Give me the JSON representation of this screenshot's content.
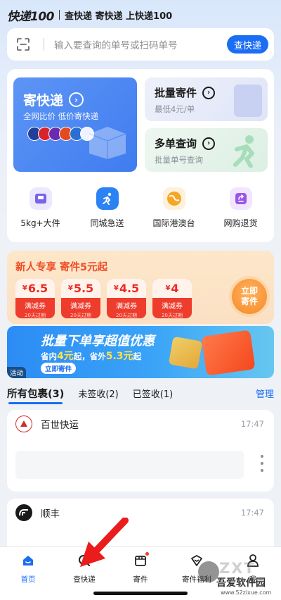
{
  "header": {
    "logo": "快递100",
    "slogan": "查快递 寄快递 上快递100"
  },
  "search": {
    "placeholder": "输入要查询的单号或扫码单号",
    "button": "查快递"
  },
  "services": {
    "send": {
      "title": "寄快递",
      "subtitle": "全网比价 低价寄快递",
      "arrow": "›"
    },
    "batch_send": {
      "title": "批量寄件",
      "subtitle": "最低4元/单",
      "arrow": "›"
    },
    "multi_query": {
      "title": "多单查询",
      "subtitle": "批量单号查询",
      "arrow": "›"
    },
    "grid": [
      {
        "label": "5kg+大件",
        "icon": "scale-icon",
        "color": "#7a63e6"
      },
      {
        "label": "同城急送",
        "icon": "runner-icon",
        "color": "#2b82f3"
      },
      {
        "label": "国际港澳台",
        "icon": "globe-icon",
        "color": "#f6a623"
      },
      {
        "label": "网购退货",
        "icon": "return-icon",
        "color": "#9b55e8"
      }
    ]
  },
  "promo": {
    "title": "新人专享 寄件5元起",
    "coupons": [
      {
        "currency": "¥",
        "amount": "6.5",
        "label": "满减券",
        "expire": "20天过期"
      },
      {
        "currency": "¥",
        "amount": "5.5",
        "label": "满减券",
        "expire": "20天过期"
      },
      {
        "currency": "¥",
        "amount": "4.5",
        "label": "满减券",
        "expire": "20天过期"
      },
      {
        "currency": "¥",
        "amount": "4",
        "label": "满减券",
        "expire": "20天过期"
      }
    ],
    "cta_line1": "立即",
    "cta_line2": "寄件"
  },
  "banner": {
    "headline": "批量下单享超值优惠",
    "sub_a": "省内",
    "sub_b": "4元",
    "sub_c": "起，省外",
    "sub_d": "5.3元",
    "sub_e": "起",
    "button": "立即寄件",
    "tag": "活动"
  },
  "tabs": {
    "all": "所有包裹(3)",
    "unsigned": "未签收(2)",
    "signed": "已签收(1)",
    "manage": "管理"
  },
  "packages": [
    {
      "carrier": "百世快运",
      "time": "17:47",
      "logo_color": "#d22b2b"
    },
    {
      "carrier": "顺丰",
      "time": "17:47",
      "logo_color": "#1a1a1a"
    }
  ],
  "nav": {
    "items": [
      {
        "label": "首页",
        "icon": "home-icon"
      },
      {
        "label": "查快递",
        "icon": "search-icon"
      },
      {
        "label": "寄件",
        "icon": "box-icon"
      },
      {
        "label": "寄件福利",
        "icon": "gift-icon"
      },
      {
        "label": "我",
        "icon": "user-icon"
      }
    ],
    "active_color": "#1b6ef3"
  },
  "watermark": {
    "site": "吾爱软件园",
    "url": "www.52zixue.com",
    "overlay": "ZXT"
  }
}
